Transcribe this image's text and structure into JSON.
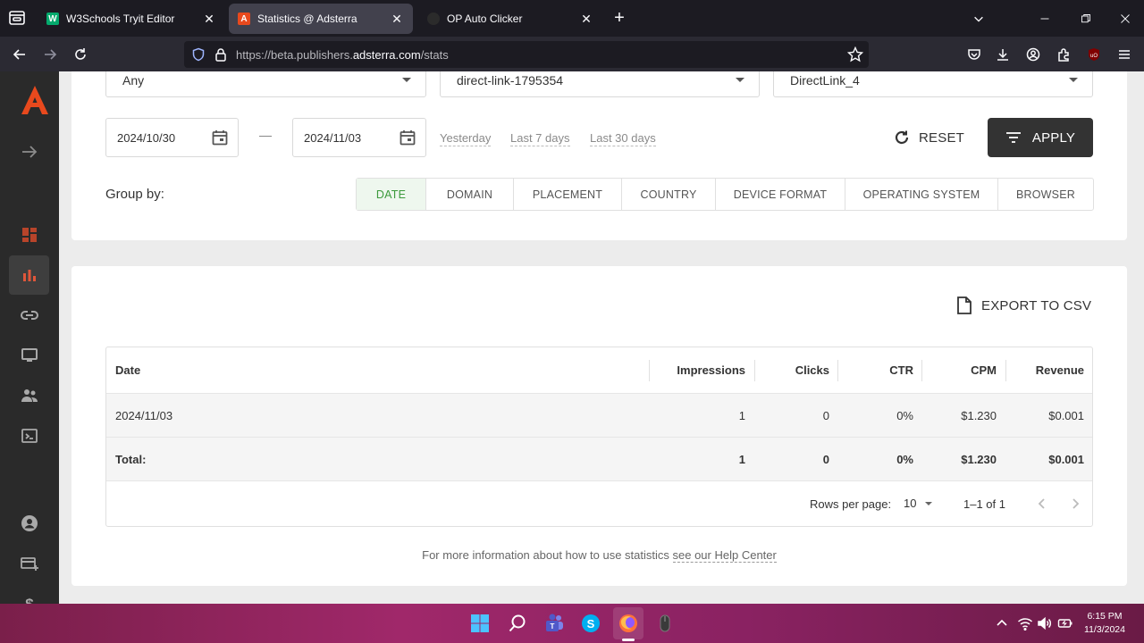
{
  "browser": {
    "tabs": [
      {
        "title": "W3Schools Tryit Editor",
        "favicon": "w3schools-icon",
        "active": false
      },
      {
        "title": "Statistics @ Adsterra",
        "favicon": "adsterra-icon",
        "active": true
      },
      {
        "title": "OP Auto Clicker",
        "favicon": "dot-icon",
        "active": false
      }
    ],
    "url_prefix": "https://beta.publishers.",
    "url_domain": "adsterra.com",
    "url_path": "/stats"
  },
  "filters": {
    "select1": "Any",
    "select2": "direct-link-1795354",
    "select3": "DirectLink_4",
    "date_from": "2024/10/30",
    "date_to": "2024/11/03",
    "quick_ranges": [
      "Yesterday",
      "Last 7 days",
      "Last 30 days"
    ],
    "reset_label": "RESET",
    "apply_label": "APPLY"
  },
  "group_by": {
    "label": "Group by:",
    "options": [
      "DATE",
      "DOMAIN",
      "PLACEMENT",
      "COUNTRY",
      "DEVICE FORMAT",
      "OPERATING SYSTEM",
      "BROWSER"
    ],
    "active": "DATE"
  },
  "export_label": "EXPORT TO CSV",
  "table": {
    "headers": [
      "Date",
      "Impressions",
      "Clicks",
      "CTR",
      "CPM",
      "Revenue"
    ],
    "rows": [
      [
        "2024/11/03",
        "1",
        "0",
        "0%",
        "$1.230",
        "$0.001"
      ]
    ],
    "total": [
      "Total:",
      "1",
      "0",
      "0%",
      "$1.230",
      "$0.001"
    ]
  },
  "pagination": {
    "rows_per_page_label": "Rows per page:",
    "rows_per_page": "10",
    "range": "1–1 of 1"
  },
  "help": {
    "text": "For more information about how to use statistics",
    "link": "see our Help Center"
  },
  "taskbar": {
    "time": "6:15 PM",
    "date": "11/3/2024"
  },
  "colors": {
    "brand": "#e8491d",
    "active_tab_green": "#3c9a3c",
    "sidebar_bg": "#2a2a2a",
    "apply_bg": "#333333"
  }
}
